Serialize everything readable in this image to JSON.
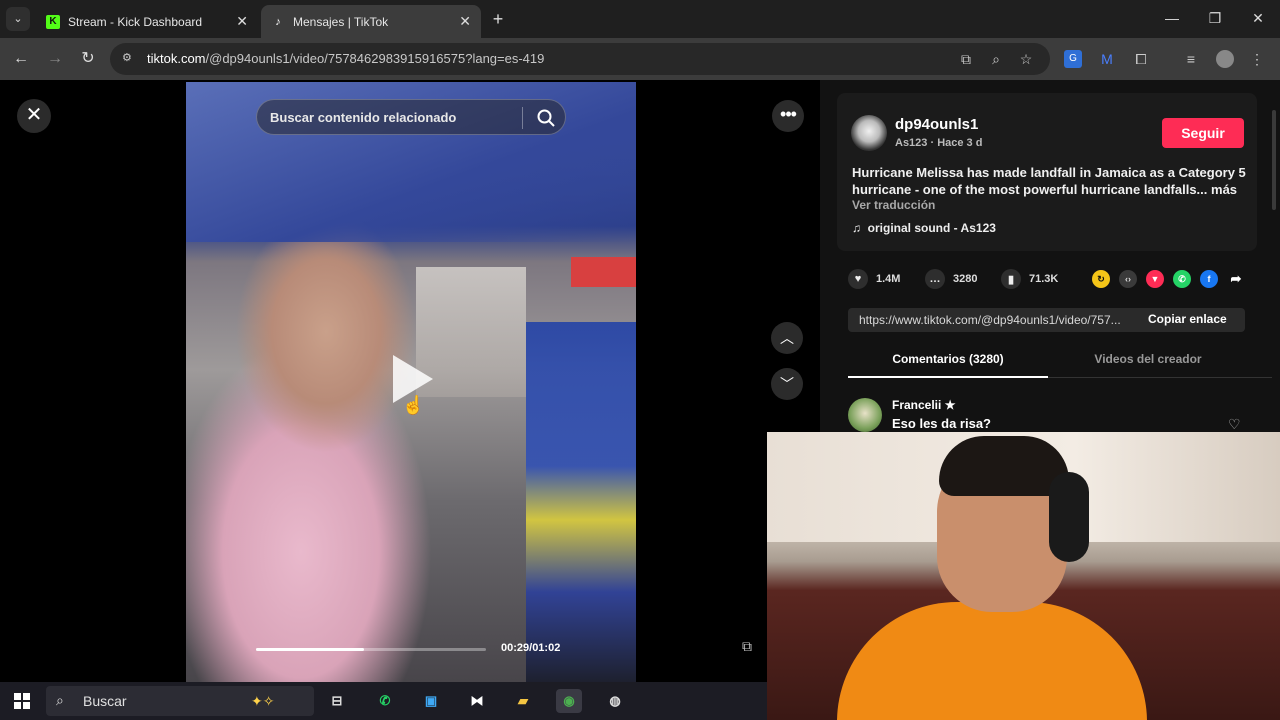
{
  "browser": {
    "tabs": [
      {
        "title": "Stream - Kick Dashboard",
        "favicon": "kick-logo-icon",
        "active": false
      },
      {
        "title": "Mensajes | TikTok",
        "favicon": "tiktok-logo-icon",
        "active": true
      }
    ],
    "url_domain": "tiktok.com",
    "url_path": "/@dp94ounls1/video/7578462983915916575?lang=es-419"
  },
  "video": {
    "search_placeholder": "Buscar contenido relacionado",
    "progress": 0.47,
    "timecode": "00:29/01:02"
  },
  "post": {
    "username": "dp94ounls1",
    "subtitle": "As123 · Hace 3 d",
    "follow_label": "Seguir",
    "description": "Hurricane Melissa has made landfall in Jamaica as a Category 5 hurricane - one of the most powerful hurricane landfalls...",
    "more_label": "más",
    "translate_label": "Ver traducción",
    "sound": "original sound - As123",
    "likes": "1.4M",
    "comments": "3280",
    "saves": "71.3K",
    "link": "https://www.tiktok.com/@dp94ounls1/video/757...",
    "copy_label": "Copiar enlace",
    "tab_comments": "Comentarios (3280)",
    "tab_videos": "Videos del creador"
  },
  "comment": {
    "author": "Francelii ★",
    "text": "Eso les da risa?"
  },
  "taskbar": {
    "search_label": "Buscar"
  },
  "colors": {
    "follow_button": "#fe2c55",
    "kick_green": "#53fc18",
    "webcam_shirt": "#f08a14"
  }
}
